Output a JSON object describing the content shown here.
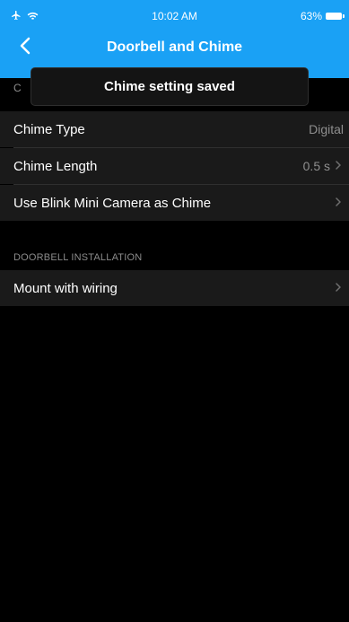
{
  "status_bar": {
    "time": "10:02 AM",
    "battery": "63%",
    "airplane_icon": "airplane-icon",
    "wifi_icon": "wifi-icon",
    "battery_icon": "battery-icon"
  },
  "nav": {
    "title": "Doorbell and Chime",
    "back_icon": "chevron-left-icon"
  },
  "toast": {
    "message": "Chime setting saved"
  },
  "sections": [
    {
      "header": "C",
      "items": [
        {
          "label": "Chime Type",
          "value": "Digital",
          "chevron": false
        },
        {
          "label": "Chime Length",
          "value": "0.5 s",
          "chevron": true
        },
        {
          "label": "Use Blink Mini Camera as Chime",
          "value": "",
          "chevron": true
        }
      ]
    },
    {
      "header": "DOORBELL INSTALLATION",
      "items": [
        {
          "label": "Mount with wiring",
          "value": "",
          "chevron": true
        }
      ]
    }
  ],
  "colors": {
    "header_blue": "#1aa1f5",
    "background": "#000000",
    "row_background": "#1a1a1a",
    "secondary_text": "#8f8f8f"
  }
}
